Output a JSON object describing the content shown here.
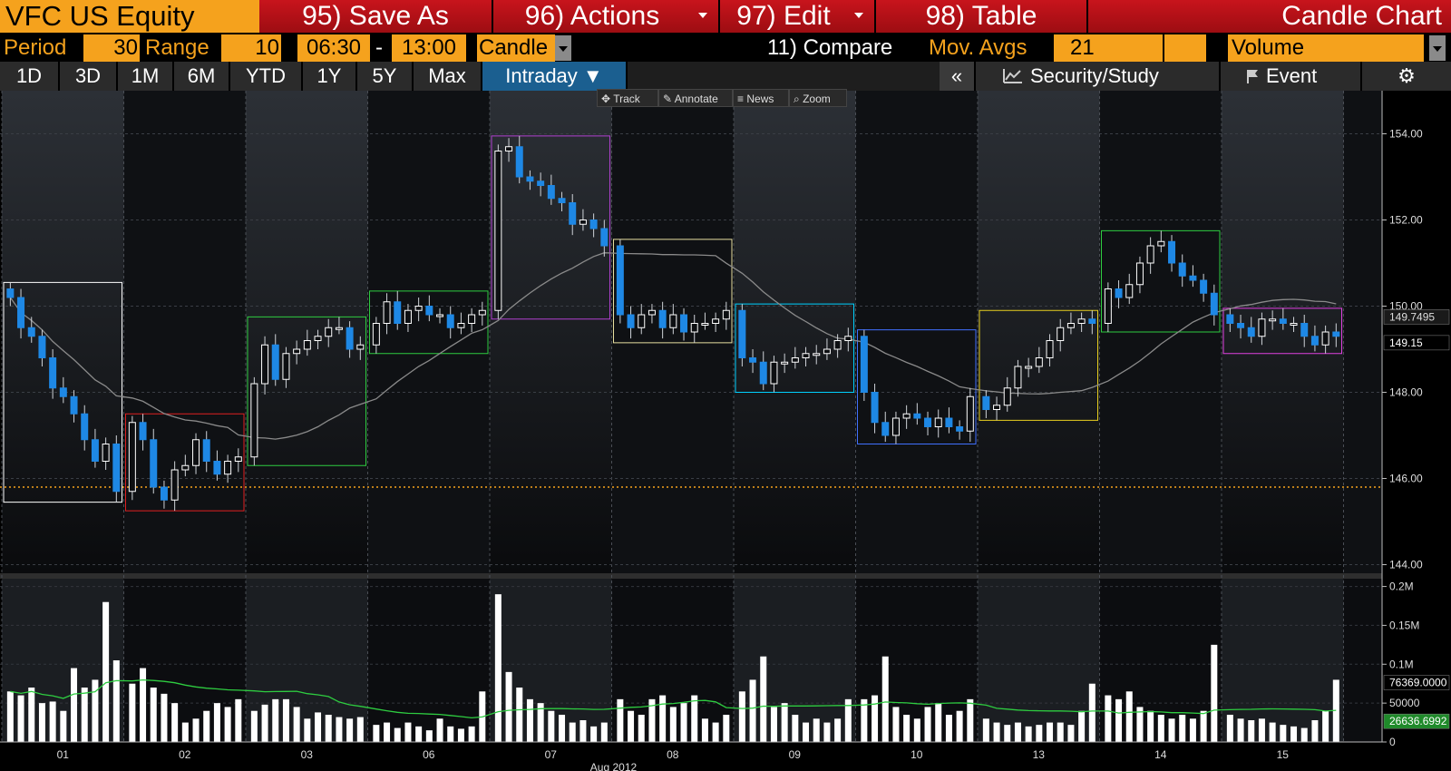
{
  "topbar": {
    "ticker": "VFC US Equity",
    "save_as": "95) Save As",
    "actions": "96) Actions",
    "edit": "97) Edit",
    "table": "98) Table",
    "chart_type_title": "Candle Chart"
  },
  "settings": {
    "period_label": "Period",
    "period_value": "30",
    "range_label": "Range",
    "range_value": "10",
    "start_time": "06:30",
    "dash": "-",
    "end_time": "13:00",
    "style": "Candle",
    "compare": "11) Compare",
    "mov_avgs_label": "Mov. Avgs",
    "mov_avgs_value": "21",
    "volume": "Volume"
  },
  "tabs": [
    "1D",
    "3D",
    "1M",
    "6M",
    "YTD",
    "1Y",
    "5Y",
    "Max"
  ],
  "active_tab": "Intraday ▼",
  "right_tabs": {
    "collapse": "«",
    "security_study": "Security/Study",
    "event": "Event"
  },
  "tools": {
    "track": "Track",
    "annotate": "Annotate",
    "news": "News",
    "zoom": "Zoom"
  },
  "colors": {
    "bearish": "#1e88e5",
    "bullish": "#ffffff",
    "accent_orange": "#f5a21d",
    "red_button": "#c8141c",
    "moving_average_price": "#8a8a8a",
    "moving_average_volume": "#2ecc40"
  },
  "chart_data": [
    {
      "type": "candlestick",
      "price_axis": {
        "ticks": [
          "154.00",
          "152.00",
          "150.00",
          "148.00",
          "146.00",
          "144.00"
        ],
        "range": [
          143.8,
          155.0
        ]
      },
      "x_labels": [
        "01",
        "02",
        "03",
        "06",
        "07",
        "08",
        "09",
        "10",
        "13",
        "14",
        "15"
      ],
      "x_month_label": "Aug 2012",
      "markers": {
        "last_price": "149.15",
        "moving_average": "149.7495"
      },
      "reference_line": 145.8,
      "days": [
        {
          "label": "01",
          "box_color": "#ffffff",
          "closes": [
            150.2,
            149.5,
            149.3,
            148.8,
            148.1,
            147.9,
            147.5,
            146.9,
            146.4,
            146.8,
            145.7
          ]
        },
        {
          "label": "02",
          "box_color": "#e02020",
          "closes": [
            147.3,
            146.9,
            145.8,
            145.5,
            146.2,
            146.3,
            146.9,
            146.4,
            146.1,
            146.4,
            146.5
          ]
        },
        {
          "label": "03",
          "box_color": "#2ecc40",
          "closes": [
            148.2,
            149.1,
            148.3,
            148.9,
            149.0,
            149.2,
            149.3,
            149.5,
            149.5,
            149.0,
            149.1
          ]
        },
        {
          "label": "06",
          "box_color": "#2ecc40",
          "closes": [
            149.6,
            150.1,
            149.6,
            149.9,
            150.0,
            149.8,
            149.8,
            149.5,
            149.6,
            149.8,
            149.9
          ]
        },
        {
          "label": "07",
          "box_color": "#b040d0",
          "closes": [
            153.6,
            153.7,
            153.0,
            152.9,
            152.8,
            152.5,
            152.4,
            151.9,
            152.0,
            151.8,
            151.4
          ]
        },
        {
          "label": "08",
          "box_color": "#e8e0a0",
          "closes": [
            149.8,
            149.5,
            149.8,
            149.9,
            149.5,
            149.8,
            149.4,
            149.6,
            149.6,
            149.7,
            149.9
          ]
        },
        {
          "label": "09",
          "box_color": "#00d0ff",
          "closes": [
            148.8,
            148.7,
            148.2,
            148.7,
            148.7,
            148.8,
            148.9,
            148.9,
            149.0,
            149.2,
            149.3
          ]
        },
        {
          "label": "10",
          "box_color": "#4070ff",
          "closes": [
            148.0,
            147.3,
            147.0,
            147.4,
            147.5,
            147.4,
            147.2,
            147.4,
            147.2,
            147.1,
            147.9
          ]
        },
        {
          "label": "13",
          "box_color": "#e8d020",
          "closes": [
            147.6,
            147.7,
            148.1,
            148.6,
            148.6,
            148.8,
            149.2,
            149.5,
            149.6,
            149.7,
            149.6
          ]
        },
        {
          "label": "14",
          "box_color": "#2ecc40",
          "closes": [
            150.4,
            150.2,
            150.5,
            151.0,
            151.4,
            151.5,
            151.0,
            150.7,
            150.6,
            150.3,
            149.8
          ]
        },
        {
          "label": "15",
          "box_color": "#e040e0",
          "closes": [
            149.6,
            149.5,
            149.3,
            149.7,
            149.7,
            149.6,
            149.6,
            149.3,
            149.1,
            149.4,
            149.3
          ]
        }
      ]
    },
    {
      "type": "bar",
      "title": "Volume",
      "axis_ticks": [
        "0.2M",
        "0.15M",
        "0.1M",
        "50000",
        "0"
      ],
      "range": [
        0,
        210000
      ],
      "markers": {
        "volume": "76369.0000",
        "moving_average": "26636.6992"
      },
      "days": [
        {
          "label": "01",
          "values": [
            65000,
            60000,
            70000,
            50000,
            52000,
            40000,
            95000,
            70000,
            80000,
            180000,
            105000
          ]
        },
        {
          "label": "02",
          "values": [
            75000,
            95000,
            70000,
            62000,
            50000,
            25000,
            30000,
            40000,
            50000,
            45000,
            55000
          ]
        },
        {
          "label": "03",
          "values": [
            40000,
            48000,
            55000,
            55000,
            45000,
            30000,
            38000,
            35000,
            32000,
            30000,
            32000
          ]
        },
        {
          "label": "06",
          "values": [
            22000,
            25000,
            18000,
            25000,
            20000,
            15000,
            30000,
            20000,
            17000,
            20000,
            65000
          ]
        },
        {
          "label": "07",
          "values": [
            190000,
            90000,
            70000,
            55000,
            50000,
            40000,
            35000,
            25000,
            28000,
            20000,
            25000
          ]
        },
        {
          "label": "08",
          "values": [
            55000,
            40000,
            35000,
            55000,
            60000,
            45000,
            50000,
            60000,
            30000,
            25000,
            35000
          ]
        },
        {
          "label": "09",
          "values": [
            65000,
            80000,
            110000,
            45000,
            50000,
            35000,
            25000,
            30000,
            25000,
            30000,
            55000
          ]
        },
        {
          "label": "10",
          "values": [
            55000,
            60000,
            110000,
            45000,
            35000,
            30000,
            45000,
            50000,
            35000,
            40000,
            55000
          ]
        },
        {
          "label": "13",
          "values": [
            30000,
            25000,
            22000,
            25000,
            20000,
            22000,
            25000,
            25000,
            22000,
            40000,
            75000
          ]
        },
        {
          "label": "14",
          "values": [
            60000,
            55000,
            65000,
            45000,
            40000,
            35000,
            30000,
            35000,
            30000,
            40000,
            125000
          ]
        },
        {
          "label": "15",
          "values": [
            35000,
            30000,
            28000,
            30000,
            25000,
            22000,
            20000,
            18000,
            28000,
            40000,
            80000
          ]
        }
      ]
    }
  ]
}
